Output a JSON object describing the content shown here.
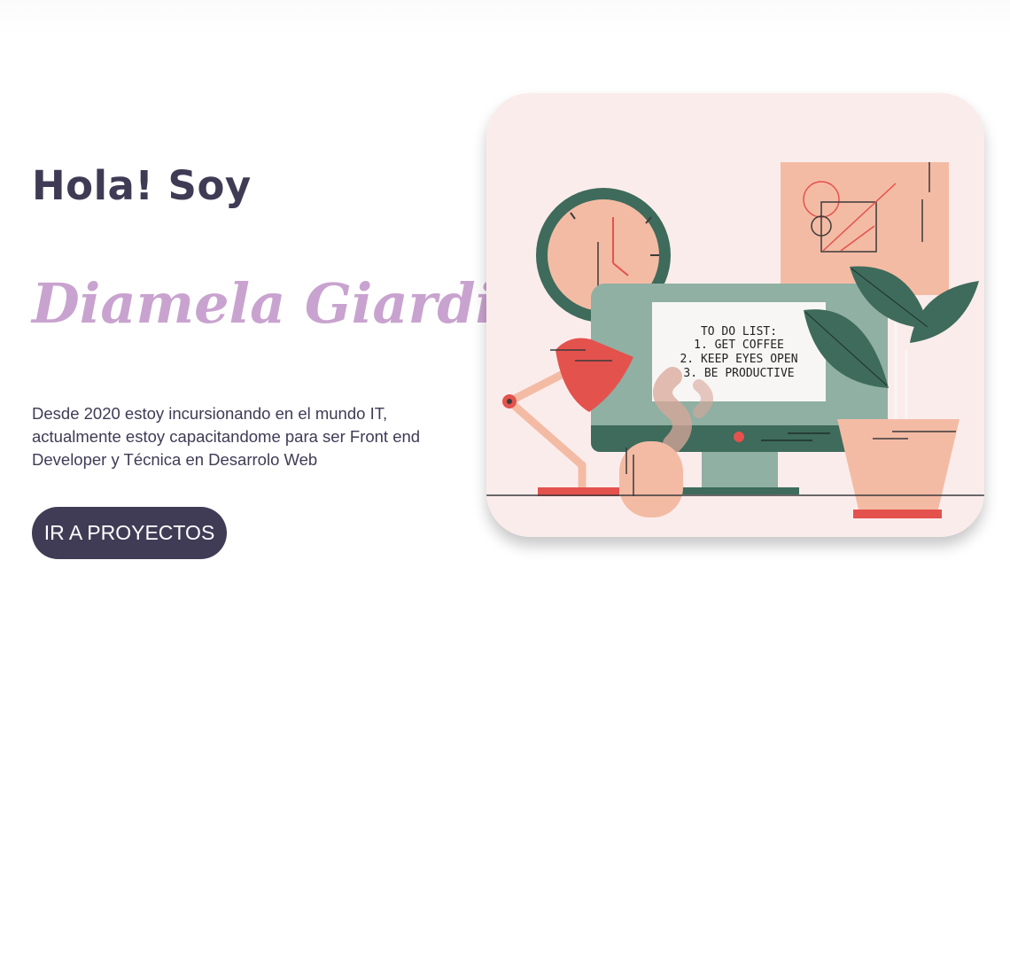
{
  "hero": {
    "greeting": "Hola! Soy",
    "name": "Diamela Giardini",
    "intro": "Desde 2020 estoy incursionando en el mundo IT, actualmente estoy capacitandome para ser Front end Developer y Técnica en Desarrolo Web",
    "cta_label": "IR A PROYECTOS"
  },
  "illustration": {
    "todo_title": "TO DO LIST:",
    "todo_items": [
      "1. GET COFFEE",
      "2. KEEP EYES OPEN",
      "3. BE PRODUCTIVE"
    ]
  },
  "colors": {
    "text_dark": "#3f3b55",
    "name_lilac": "#c9a3cf",
    "button_bg": "#403c56",
    "illustration_bg": "#fbecec",
    "accent_red": "#e4524d",
    "accent_green": "#3e6b5b",
    "accent_peach": "#f4bba4"
  }
}
